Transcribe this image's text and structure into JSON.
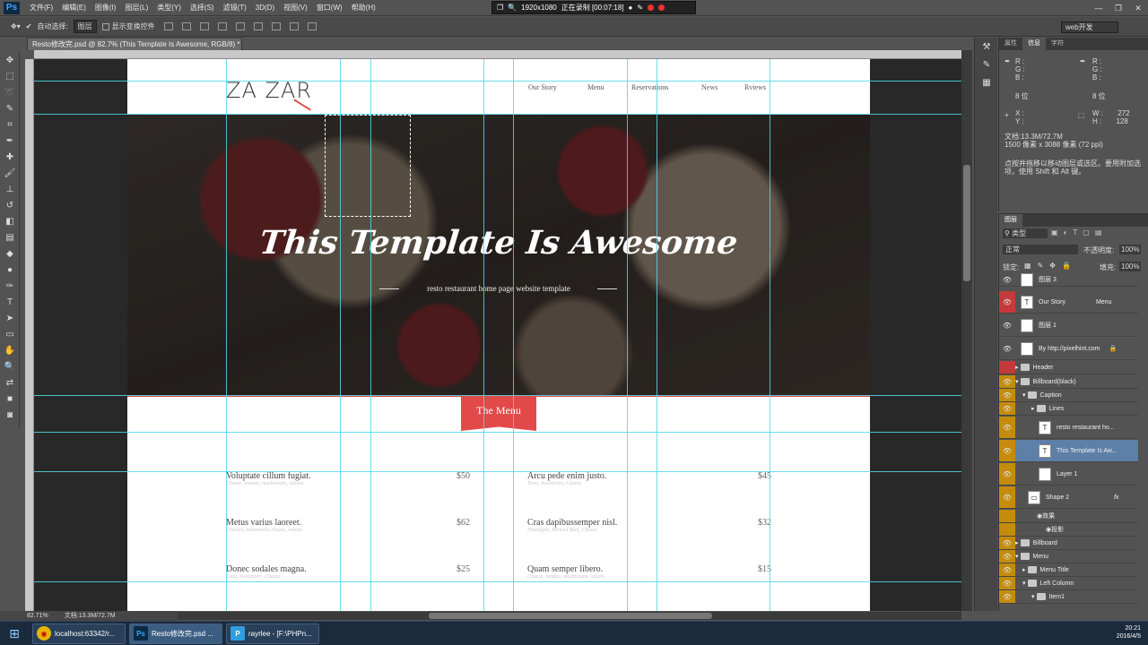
{
  "menubar": {
    "logo": "Ps",
    "items": [
      "文件(F)",
      "编辑(E)",
      "图像(I)",
      "图层(L)",
      "类型(Y)",
      "选择(S)",
      "滤镜(T)",
      "3D(D)",
      "视图(V)",
      "窗口(W)",
      "帮助(H)"
    ]
  },
  "recorder": {
    "resolution": "1920x1080",
    "status": "正在录制 [00:07:18]"
  },
  "options": {
    "auto_select_label": "自动选择:",
    "auto_select_value": "图层",
    "transform_label": "显示变换控件",
    "workspace": "web开发"
  },
  "document": {
    "tab_title": "Resto修改完.psd @ 82.7% (This Template Is Awesome, RGB/8) *",
    "zoom": "82.71%",
    "doc_size": "文档:13.3M/72.7M"
  },
  "site": {
    "logo": "ZA ZAR",
    "nav": [
      "Our Story",
      "Menu",
      "Reservations",
      "News",
      "Rviews"
    ],
    "hero_title": "This Template Is Awesome",
    "hero_subtitle": "resto restaurant home page website template",
    "menu_tab": "The Menu",
    "menu_items": [
      {
        "name": "Voluptate cillum fugiat.",
        "desc": "Cheese, tomato, mushrooms, onions",
        "price": "$50"
      },
      {
        "name": "Arcu pede enim justo.",
        "desc": "Tuna, Sweetcorn, Cheese",
        "price": "$45"
      },
      {
        "name": "Metus varius laoreet.",
        "desc": "Chicken, mozzarella cheese, onions",
        "price": "$62"
      },
      {
        "name": "Cras dapibussemper nisl.",
        "desc": "Pineapple, Minced Beef, Cheese",
        "price": "$32"
      },
      {
        "name": "Donec sodales magna.",
        "desc": "Tuna, Sweetcorn, Cheese",
        "price": "$25"
      },
      {
        "name": "Quam semper libero.",
        "desc": "Cheese, tomato, mushrooms, onions",
        "price": "$15"
      }
    ]
  },
  "info_panel": {
    "tabs": [
      "属性",
      "信息",
      "字符"
    ],
    "r_label": "R :",
    "g_label": "G :",
    "b_label": "B :",
    "bit_left": "8 位",
    "bit_right": "8 位",
    "x_label": "X :",
    "y_label": "Y :",
    "w_label": "W :",
    "w_value": "272",
    "h_label": "H :",
    "h_value": "128",
    "doc_line": "文档:13.3M/72.7M",
    "pixel_line": "1500 像素 x 3088 像素 (72 ppi)",
    "hint": "点按并拖移以移动图层或选区。要用附加选项，使用 Shift 和 Alt 键。"
  },
  "layers_panel": {
    "title": "图层",
    "filter": "类型",
    "blend": "正常",
    "opacity_label": "不透明度:",
    "opacity": "100%",
    "lock_label": "锁定:",
    "fill_label": "填充:",
    "fill": "100%",
    "layers": [
      {
        "name": "图层 3",
        "kind": "pixel",
        "eye": "none"
      },
      {
        "name": "Our Story",
        "extra": "Menu",
        "kind": "text",
        "eye": "red"
      },
      {
        "name": "图层 1",
        "kind": "pixel",
        "eye": "none"
      },
      {
        "name": "By http://pixelhint.com",
        "kind": "pixel",
        "eye": "none"
      },
      {
        "name": "Header",
        "kind": "group",
        "eye": "red"
      },
      {
        "name": "Billboard(black)",
        "kind": "group",
        "eye": "yellow"
      },
      {
        "name": "Caption",
        "kind": "group",
        "eye": "yellow"
      },
      {
        "name": "Lines",
        "kind": "group",
        "eye": "yellow"
      },
      {
        "name": "resto restaurant ho...",
        "kind": "text",
        "eye": "yellow"
      },
      {
        "name": "This Template Is Aw...",
        "kind": "text",
        "eye": "yellow",
        "selected": true
      },
      {
        "name": "Layer 1",
        "kind": "pixel",
        "eye": "yellow"
      },
      {
        "name": "Shape 2",
        "kind": "shape",
        "eye": "yellow"
      },
      {
        "name": "效果",
        "kind": "effect",
        "eye": "yellow"
      },
      {
        "name": "投影",
        "kind": "effect",
        "eye": "yellow"
      },
      {
        "name": "Billboard",
        "kind": "group",
        "eye": "yellow"
      },
      {
        "name": "Menu",
        "kind": "group",
        "eye": "yellow"
      },
      {
        "name": "Menu Title",
        "kind": "group",
        "eye": "yellow"
      },
      {
        "name": "Left Column",
        "kind": "group",
        "eye": "yellow"
      },
      {
        "name": "Item1",
        "kind": "group",
        "eye": "yellow"
      }
    ]
  },
  "taskbar": {
    "tasks": [
      "localhost:63342/r...",
      "Resto修改完.psd ...",
      "rayrlee - [F:\\PHPn..."
    ],
    "time": "20:21",
    "date": "2016/4/5"
  },
  "colors": {
    "accent": "#e24a4a",
    "guide": "#4fd8e8",
    "panel": "#535353"
  }
}
